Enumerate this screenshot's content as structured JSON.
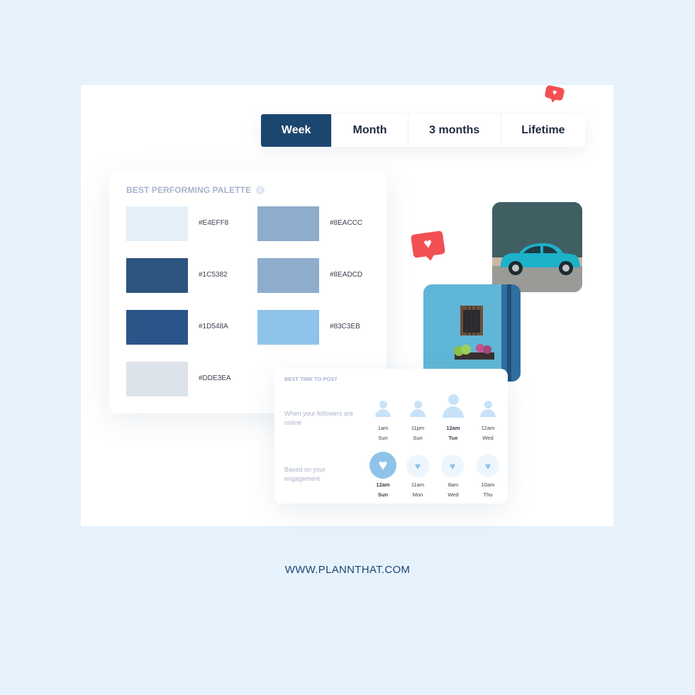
{
  "tabs": [
    {
      "label": "Week",
      "active": true
    },
    {
      "label": "Month",
      "active": false
    },
    {
      "label": "3 months",
      "active": false
    },
    {
      "label": "Lifetime",
      "active": false
    }
  ],
  "palette": {
    "title": "BEST PERFORMING PALETTE",
    "info_icon": "i",
    "swatches": [
      {
        "hex": "#E4EFF8",
        "color": "#E4EFF8"
      },
      {
        "hex": "#8EACCC",
        "color": "#8EACCC"
      },
      {
        "hex": "#1C5382",
        "color": "#2C5580"
      },
      {
        "hex": "#8EADCD",
        "color": "#8EADCD"
      },
      {
        "hex": "#1D548A",
        "color": "#2B5588"
      },
      {
        "hex": "#83C3EB",
        "color": "#8FC3E9"
      },
      {
        "hex": "#DDE3EA",
        "color": "#DDE3EA"
      }
    ]
  },
  "best_time": {
    "title": "BEST TIME TO POST",
    "followers_label": "When your followers are online",
    "engagement_label": "Based on your engagement",
    "followers": [
      {
        "time": "1am",
        "day": "Sun",
        "highlight": false
      },
      {
        "time": "11pm",
        "day": "Sun",
        "highlight": false
      },
      {
        "time": "12am",
        "day": "Tue",
        "highlight": true
      },
      {
        "time": "12am",
        "day": "Wed",
        "highlight": false
      }
    ],
    "engagement": [
      {
        "time": "12am",
        "day": "Sun",
        "highlight": true
      },
      {
        "time": "11am",
        "day": "Mon",
        "highlight": false
      },
      {
        "time": "8am",
        "day": "Wed",
        "highlight": false
      },
      {
        "time": "10am",
        "day": "Thu",
        "highlight": false
      }
    ]
  },
  "icons": {
    "heart": "♥"
  },
  "colors": {
    "accent": "#1B4670",
    "like": "#F25052",
    "light_blue": "#8FC3E9",
    "background": "#E6F2FC"
  },
  "footer": {
    "url": "WWW.PLANNTHAT.COM"
  }
}
